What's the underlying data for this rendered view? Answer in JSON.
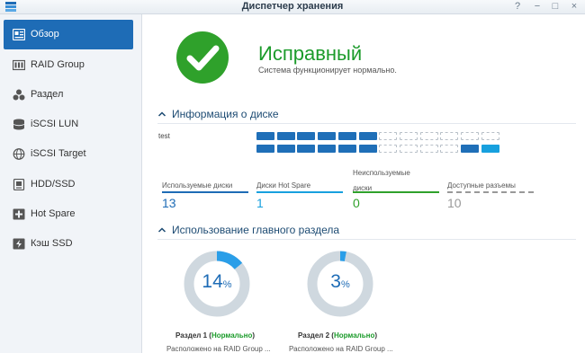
{
  "window": {
    "title": "Диспетчер хранения",
    "help_symbol": "?",
    "minimize_symbol": "−",
    "maximize_symbol": "□",
    "close_symbol": "×"
  },
  "sidebar": {
    "items": [
      {
        "label": "Обзор",
        "icon": "overview-icon",
        "active": true
      },
      {
        "label": "RAID Group",
        "icon": "raid-group-icon",
        "active": false
      },
      {
        "label": "Раздел",
        "icon": "volume-icon",
        "active": false
      },
      {
        "label": "iSCSI LUN",
        "icon": "iscsi-lun-icon",
        "active": false
      },
      {
        "label": "iSCSI Target",
        "icon": "iscsi-target-icon",
        "active": false
      },
      {
        "label": "HDD/SSD",
        "icon": "hdd-icon",
        "active": false
      },
      {
        "label": "Hot Spare",
        "icon": "hot-spare-icon",
        "active": false
      },
      {
        "label": "Кэш SSD",
        "icon": "ssd-cache-icon",
        "active": false
      }
    ]
  },
  "status": {
    "title": "Исправный",
    "description": "Система функционирует нормально.",
    "color": "#2fa12b"
  },
  "disk_info": {
    "section_title": "Информация о диске",
    "unit_name": "test",
    "slot_rows": [
      [
        "used",
        "used",
        "used",
        "used",
        "used",
        "used",
        "empty",
        "empty",
        "empty",
        "empty",
        "empty",
        "empty"
      ],
      [
        "used",
        "used",
        "used",
        "used",
        "used",
        "used",
        "empty",
        "empty",
        "empty",
        "empty",
        "used",
        "spare"
      ]
    ],
    "stats": [
      {
        "label": "Используемые диски",
        "value": "13",
        "color": "#1e6cb6"
      },
      {
        "label": "Диски Hot Spare",
        "value": "1",
        "color": "#17a0de"
      },
      {
        "label": "Неиспользуемые\nдиски",
        "value": "0",
        "color": "#2fa12b"
      },
      {
        "label": "Доступные разъемы",
        "value": "10",
        "color": "#999999"
      }
    ]
  },
  "volume_usage": {
    "section_title": "Использование главного раздела",
    "volumes": [
      {
        "percent": 14,
        "percent_sign": "%",
        "title": "Раздел 1",
        "status": "Нормально",
        "location": "Расположено на RAID Group ..."
      },
      {
        "percent": 3,
        "percent_sign": "%",
        "title": "Раздел 2",
        "status": "Нормально",
        "location": "Расположено на RAID Group ..."
      }
    ]
  },
  "colors": {
    "accent": "#1e6cb6",
    "ok": "#1b9b2a",
    "donut_track": "#cfd8df"
  }
}
